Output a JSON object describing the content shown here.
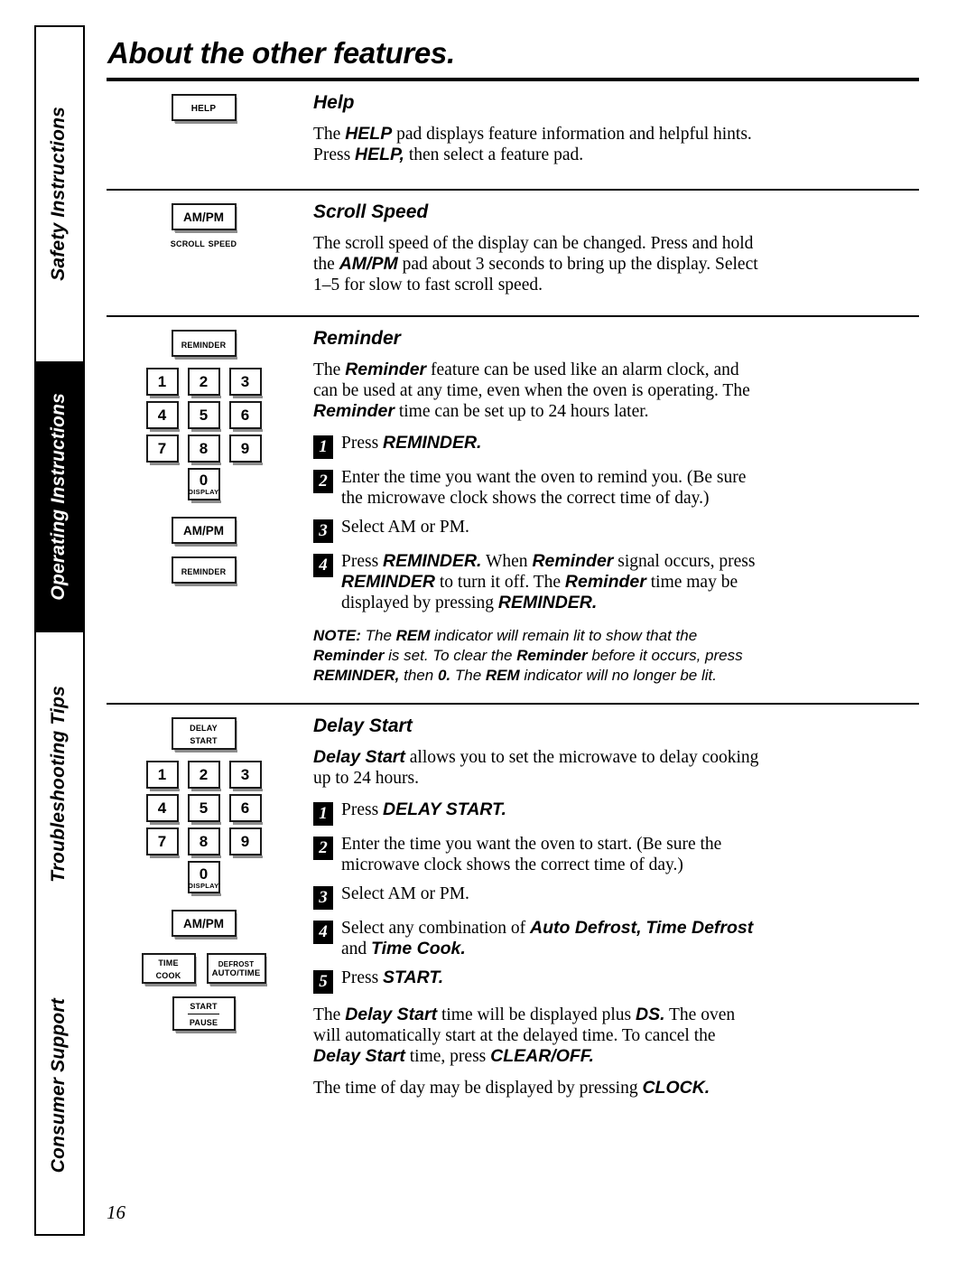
{
  "page": {
    "title": "About the other features.",
    "number": "16"
  },
  "sidebar": {
    "tabs": [
      {
        "label": "Safety Instructions",
        "active": false
      },
      {
        "label": "Operating Instructions",
        "active": true
      },
      {
        "label": "Troubleshooting Tips",
        "active": false
      },
      {
        "label": "Consumer Support",
        "active": false
      }
    ]
  },
  "keypad": {
    "digits": [
      "1",
      "2",
      "3",
      "4",
      "5",
      "6",
      "7",
      "8",
      "9"
    ],
    "zero": "0",
    "zero_sub": "DISPLAY",
    "ampm": "AM/PM"
  },
  "sections": [
    {
      "id": "help",
      "heading": "Help",
      "button_label": "Help",
      "paragraphs": [
        "The HELP pad displays feature information and helpful hints. Press HELP, then select a feature pad."
      ]
    },
    {
      "id": "scroll-speed",
      "heading": "Scroll Speed",
      "button_label": "AM/PM",
      "button_sublabel": "Scroll Speed",
      "paragraphs": [
        "The scroll speed of the display can be changed. Press and hold the AM/PM pad about 3 seconds to bring up the display. Select 1–5 for slow to fast scroll speed."
      ]
    },
    {
      "id": "reminder",
      "heading": "Reminder",
      "button_label": "Reminder",
      "second_button_label": "Reminder",
      "intro": "The Reminder feature can be used like an alarm clock, and can be used at any time, even when the oven is operating. The Reminder time can be set up to 24 hours later.",
      "steps": [
        {
          "num": "1",
          "text": "Press REMINDER."
        },
        {
          "num": "2",
          "text": "Enter the time you want the oven to remind you. (Be sure the microwave clock shows the correct time of day.)"
        },
        {
          "num": "3",
          "text": "Select AM or PM."
        },
        {
          "num": "4",
          "text": "Press REMINDER. When Reminder signal occurs, press REMINDER to turn it off. The Reminder time may be displayed by pressing REMINDER."
        }
      ],
      "note": "NOTE: The REM indicator will remain lit to show that the Reminder is set. To clear the Reminder before it occurs, press REMINDER, then 0. The REM indicator will no longer be lit."
    },
    {
      "id": "delay-start",
      "heading": "Delay Start",
      "button_label_line1": "Delay",
      "button_label_line2": "Start",
      "time_cook_line1": "Time",
      "time_cook_line2": "Cook",
      "defrost_line1": "Defrost",
      "defrost_line2": "AUTO/TIME",
      "start_pause_line1": "Start",
      "start_pause_line2": "Pause",
      "intro": "Delay Start allows you to set the microwave to delay cooking up to 24 hours.",
      "steps": [
        {
          "num": "1",
          "text": "Press DELAY START."
        },
        {
          "num": "2",
          "text": "Enter the time you want the oven to start. (Be sure the microwave clock shows the correct time of day.)"
        },
        {
          "num": "3",
          "text": "Select AM or PM."
        },
        {
          "num": "4",
          "text": "Select any combination of Auto Defrost, Time Defrost and Time Cook."
        },
        {
          "num": "5",
          "text": "Press START."
        }
      ],
      "outro": [
        "The Delay Start time will be displayed plus DS. The oven will automatically start at the delayed time. To cancel the Delay Start time, press CLEAR/OFF.",
        "The time of day may be displayed by pressing CLOCK."
      ]
    }
  ]
}
